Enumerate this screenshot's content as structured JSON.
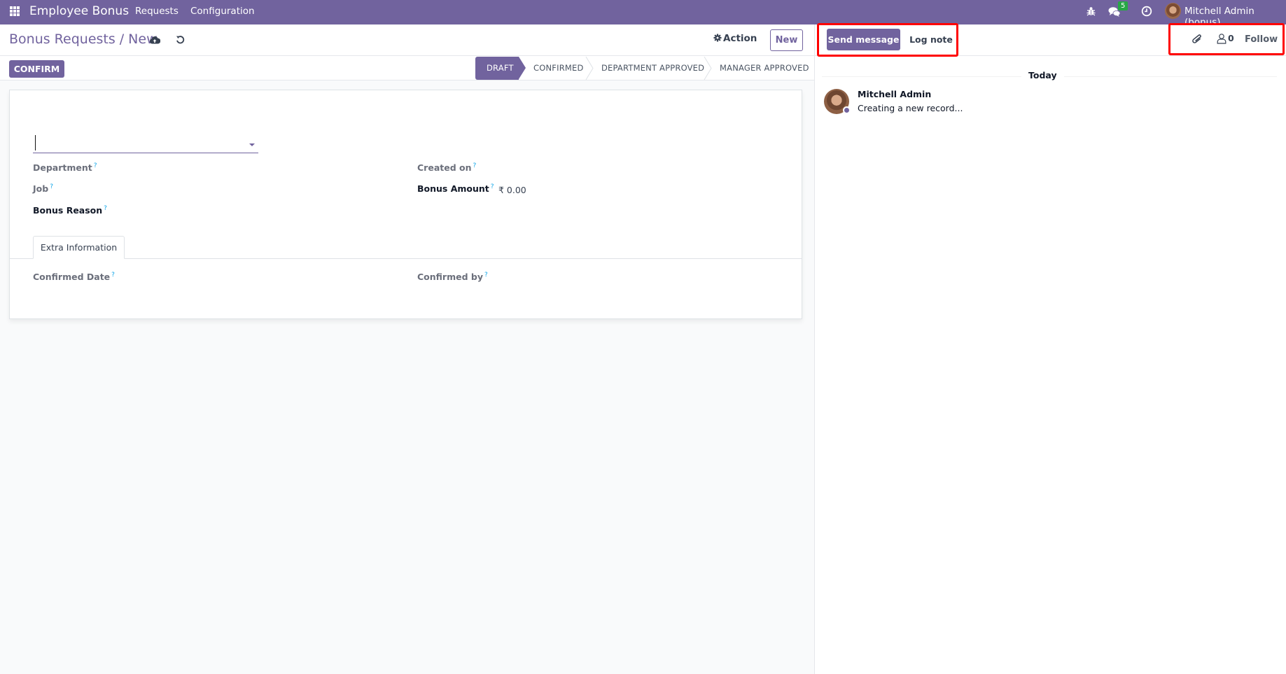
{
  "navbar": {
    "app_name": "Employee Bonus",
    "menu": [
      "Requests",
      "Configuration"
    ],
    "icons": [
      "bug-icon",
      "messages-icon",
      "activity-clock-icon"
    ],
    "messages_badge": "5",
    "user": "Mitchell Admin (bonus)"
  },
  "control_panel": {
    "breadcrumb_parent": "Bonus Requests",
    "breadcrumb_separator": "/",
    "breadcrumb_current": "New",
    "action_label": "Action",
    "new_label": "New",
    "confirm_label": "CONFIRM"
  },
  "statusbar": {
    "stages": [
      "DRAFT",
      "CONFIRMED",
      "DEPARTMENT APPROVED",
      "MANAGER APPROVED"
    ],
    "active": "DRAFT"
  },
  "form": {
    "employee_value": "",
    "tooltip_marker": "?",
    "left_fields": [
      {
        "label": "Department",
        "value": ""
      },
      {
        "label": "Job",
        "value": ""
      },
      {
        "label": "Bonus Reason",
        "value": ""
      }
    ],
    "right_fields": [
      {
        "label": "Created on",
        "value": ""
      },
      {
        "label": "Bonus Amount",
        "value": "₹ 0.00"
      }
    ],
    "tabs": [
      "Extra Information"
    ],
    "tab_fields": [
      {
        "label": "Confirmed Date",
        "value": ""
      },
      {
        "label": "Confirmed by",
        "value": ""
      }
    ]
  },
  "chatter": {
    "send_message_label": "Send message",
    "log_note_label": "Log note",
    "follower_count": "0",
    "follow_label": "Follow",
    "date_separator": "Today",
    "messages": [
      {
        "author": "Mitchell Admin",
        "body": "Creating a new record..."
      }
    ]
  },
  "colors": {
    "brand": "#71639e",
    "highlight": "#ff0000",
    "badge": "#28a745"
  }
}
